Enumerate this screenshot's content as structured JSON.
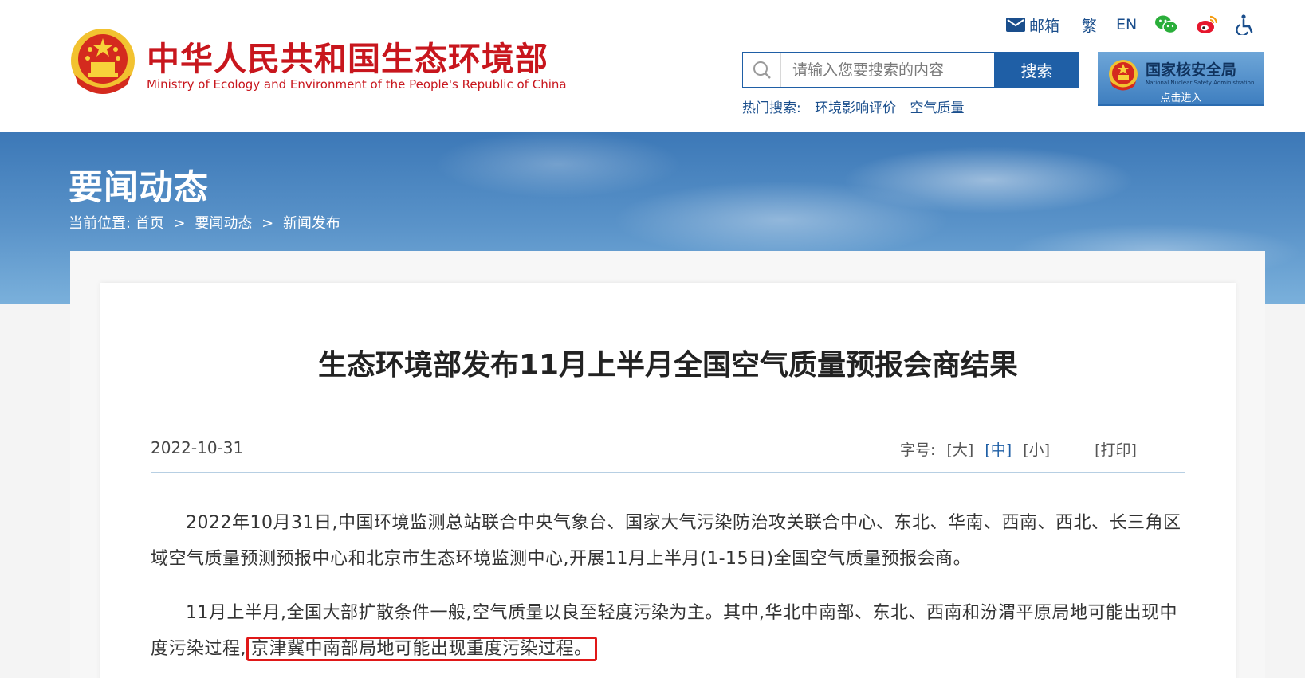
{
  "header": {
    "brand_cn": "中华人民共和国生态环境部",
    "brand_en": "Ministry of Ecology and Environment of the People's Republic of China",
    "links": {
      "mail": "邮箱",
      "traditional": "繁",
      "english": "EN"
    },
    "icons": [
      "mail-icon",
      "wechat-icon",
      "weibo-icon",
      "accessibility-icon"
    ],
    "search": {
      "placeholder": "请输入您要搜索的内容",
      "button": "搜索",
      "hot_label": "热门搜索:",
      "hot_terms": [
        "环境影响评价",
        "空气质量"
      ]
    },
    "nnsa": {
      "name_cn": "国家核安全局",
      "name_en": "National Nuclear Safety Administration",
      "enter": "点击进入"
    }
  },
  "banner": {
    "title": "要闻动态",
    "breadcrumb_label": "当前位置:",
    "breadcrumb": [
      "首页",
      "要闻动态",
      "新闻发布"
    ],
    "separator": ">"
  },
  "article": {
    "title": "生态环境部发布11月上半月全国空气质量预报会商结果",
    "date": "2022-10-31",
    "font_size_label": "字号:",
    "font_sizes": [
      "[大]",
      "[中]",
      "[小]"
    ],
    "print": "[打印]",
    "paragraphs": [
      "2022年10月31日,中国环境监测总站联合中央气象台、国家大气污染防治攻关联合中心、东北、华南、西南、西北、长三角区域空气质量预测预报中心和北京市生态环境监测中心,开展11月上半月(1-15日)全国空气质量预报会商。",
      "11月上半月,全国大部扩散条件一般,空气质量以良至轻度污染为主。其中,华北中南部、东北、西南和汾渭平原局地可能出现中度污染过程,"
    ],
    "highlight": "京津冀中南部局地可能出现重度污染过程。"
  },
  "colors": {
    "brand_red": "#c8161d",
    "link_blue": "#1a4e8c",
    "button_blue": "#1f5fa6",
    "highlight_red": "#e01818"
  }
}
